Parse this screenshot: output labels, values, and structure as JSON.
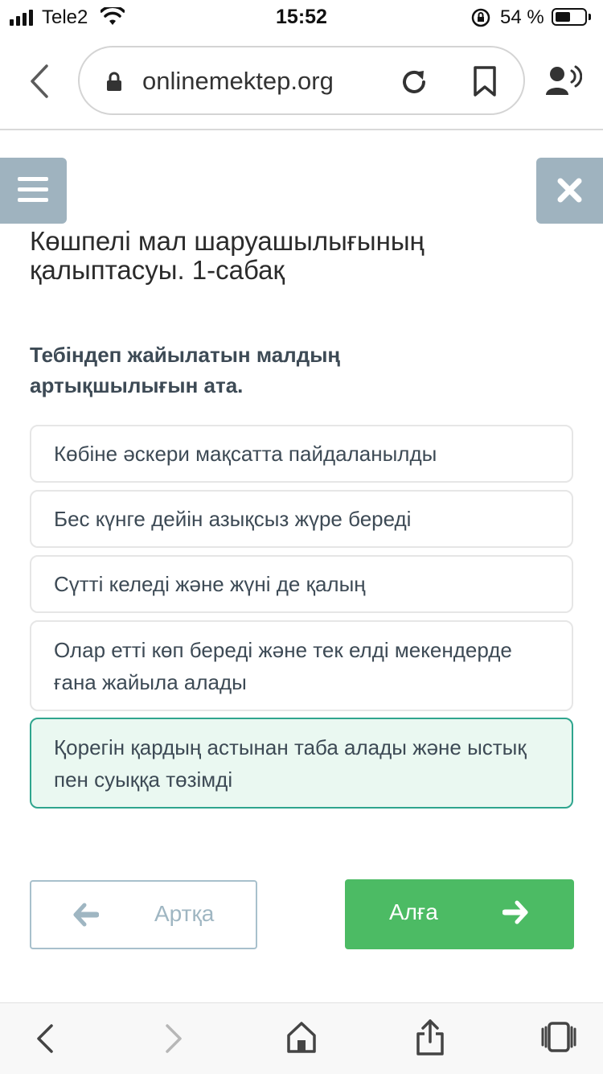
{
  "status_bar": {
    "carrier": "Tele2",
    "time": "15:52",
    "battery_percent": "54 %",
    "battery_level": 0.54
  },
  "browser": {
    "url": "onlinemektep.org"
  },
  "lesson": {
    "title": "Көшпелі мал шаруашылығының қалыптасуы. 1-сабақ"
  },
  "question": {
    "text": "Тебіндеп жайылатын малдың артықшылығын ата.",
    "options": [
      {
        "text": "Көбіне әскери мақсатта пайдаланылды",
        "selected": false
      },
      {
        "text": "Бес күнге дейін азықсыз жүре береді",
        "selected": false
      },
      {
        "text": "Сүтті келеді және жүні де қалың",
        "selected": false
      },
      {
        "text": "Олар етті көп береді және тек елді мекендерде ғана жайыла алады",
        "selected": false
      },
      {
        "text": "Қорегін қардың астынан таба алады және ыстық пен суыққа төзімді",
        "selected": true
      }
    ]
  },
  "navigation": {
    "back_label": "Артқа",
    "next_label": "Алға"
  },
  "colors": {
    "accent_green": "#4cbb64",
    "selected_border": "#2fa58e",
    "selected_bg": "#eaf8f1",
    "header_button": "#9fb3bf"
  },
  "icons": {
    "status": [
      "signal-icon",
      "wifi-icon",
      "orientation-lock-icon",
      "battery-icon"
    ],
    "browser": [
      "back-chevron-icon",
      "lock-icon",
      "reload-icon",
      "bookmark-icon",
      "speaker-icon"
    ],
    "toolbar": [
      "back-icon",
      "forward-icon",
      "home-icon",
      "share-icon",
      "tabs-icon"
    ]
  }
}
